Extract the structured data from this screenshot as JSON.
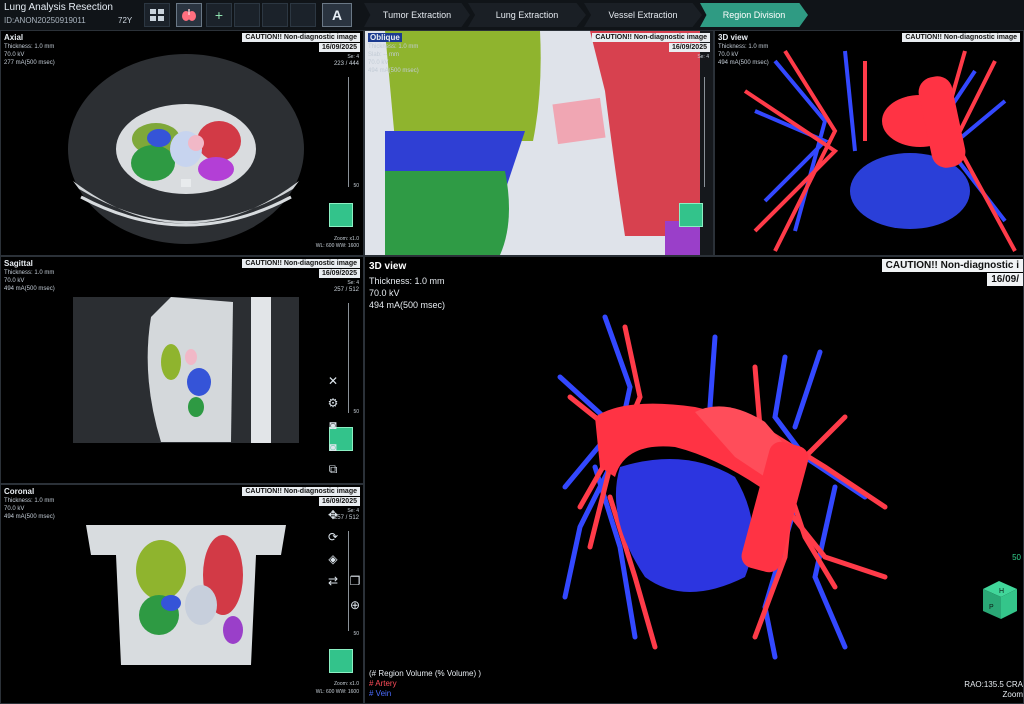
{
  "app": {
    "title": "Lung Analysis Resection",
    "patient_id": "ID:ANON20250919011",
    "age": "72Y"
  },
  "toolbar": {
    "icons": [
      "grid-icon",
      "lungs-icon",
      "plus-icon",
      "blank-icon",
      "blank-icon",
      "blank-icon",
      "text-tool-icon"
    ],
    "accent": "#2f9b83"
  },
  "workflow": {
    "tabs": [
      {
        "label": "Tumor Extraction"
      },
      {
        "label": "Lung Extraction"
      },
      {
        "label": "Vessel Extraction"
      },
      {
        "label": "Region Division",
        "active": true
      }
    ]
  },
  "caution_text": "CAUTION!! Non-diagnostic image",
  "caution_text_big": "CAUTION!! Non-diagnostic i",
  "date": "16/09/2025",
  "date_big": "16/09/",
  "panels": {
    "axial": {
      "title": "Axial",
      "info": "Thickness: 1.0 mm\n70.0 kV\n277 mA(500 msec)",
      "series": "Se: 4",
      "slice": "223 / 444",
      "scale": "50",
      "zoom": "Zoom: x1.0",
      "wlww": "WL: 600  WW: 1600"
    },
    "oblique": {
      "title": "Oblique",
      "info": "Thickness: 1.0 mm\nSlab: -- mm\n70.0 kV\n494 mA(500 msec)",
      "series": "Se: 4"
    },
    "view3d_small": {
      "title": "3D view",
      "info": "Thickness: 1.0 mm\n70.0 kV\n494 mA(500 msec)"
    },
    "sagittal": {
      "title": "Sagittal",
      "info": "Thickness: 1.0 mm\n70.0 kV\n494 mA(500 msec)",
      "series": "Se: 4",
      "slice": "257 / 512",
      "scale": "50"
    },
    "coronal": {
      "title": "Coronal",
      "info": "Thickness: 1.0 mm\n70.0 kV\n494 mA(500 msec)",
      "series": "Se: 4",
      "slice": "257 / 512",
      "scale": "50",
      "zoom": "Zoom: x1.0",
      "wlww": "WL: 600  WW: 1600"
    },
    "view3d": {
      "title": "3D view",
      "info": "Thickness: 1.0 mm\n70.0 kV\n494 mA(500 msec)",
      "legend_header": "(# Region Volume (% Volume) )",
      "legend": [
        {
          "label": "# Artery",
          "color": "#ff4d5a"
        },
        {
          "label": "# Vein",
          "color": "#4a6bff"
        }
      ],
      "orientation": "RAO:135.5 CRA",
      "zoom": "Zoom",
      "scale": "50",
      "cube_labels": [
        "H",
        "P"
      ]
    }
  },
  "side_tools": [
    "close-icon",
    "gear-icon",
    "camera-icon",
    "camera-icon",
    "camera-plus-icon",
    "move-icon",
    "rotate-icon",
    "cube-icon",
    "sync-icon",
    "layers-icon",
    "pan-icon"
  ],
  "colors": {
    "artery": "#ff4d5a",
    "vein": "#3348ff",
    "teal": "#2f9b83",
    "green_marker": "#33c38b"
  }
}
